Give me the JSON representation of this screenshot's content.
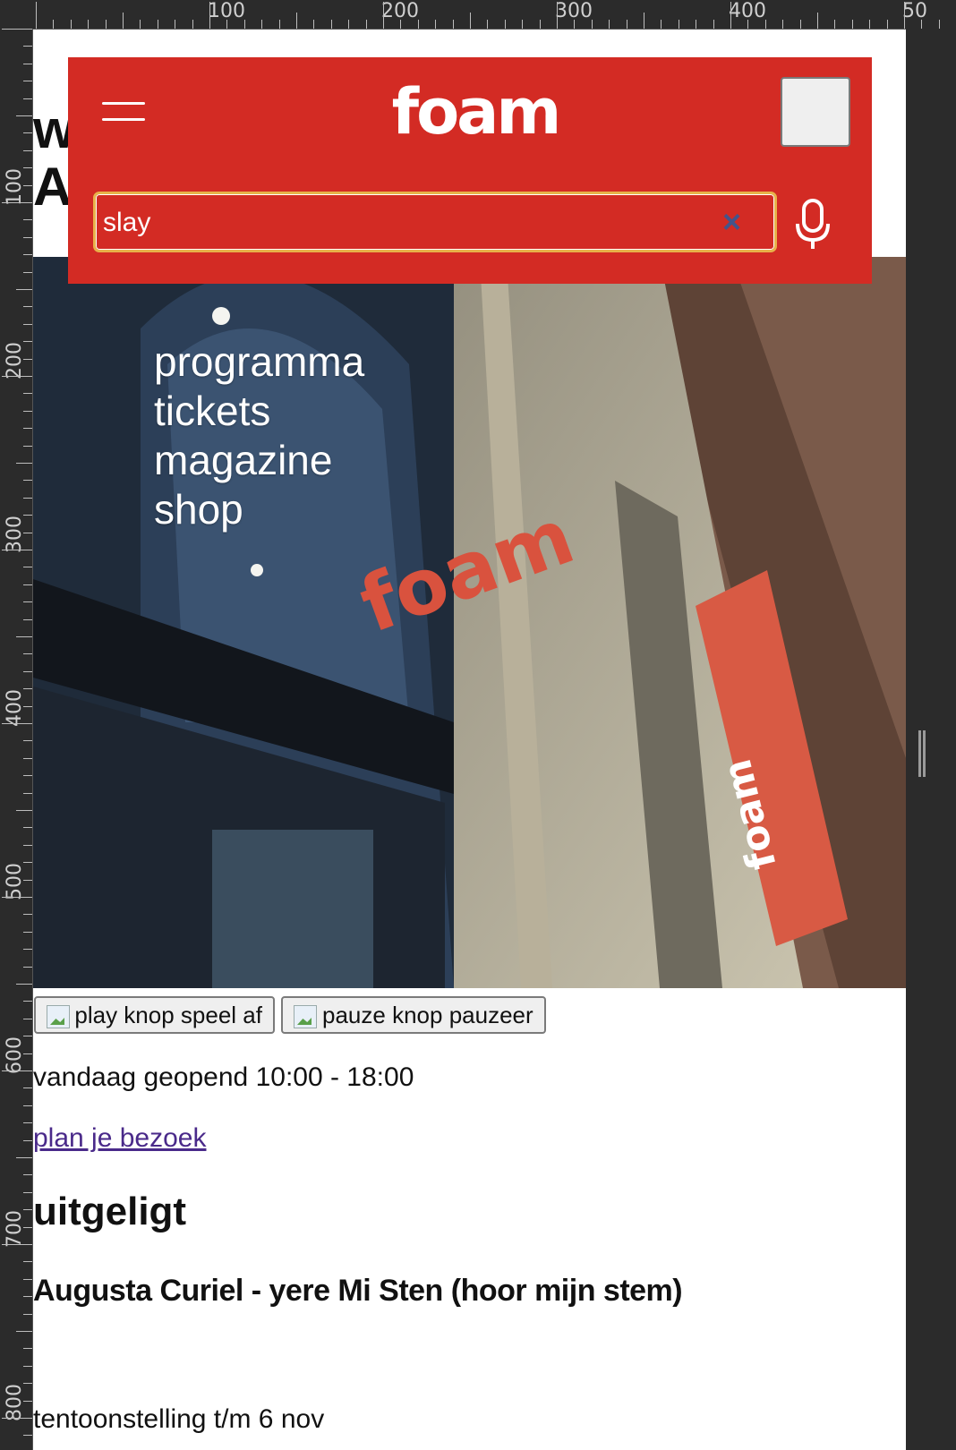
{
  "ruler": {
    "top_labels": [
      "100",
      "200",
      "300",
      "400",
      "50"
    ],
    "left_labels": [
      "100",
      "200",
      "300",
      "400",
      "500",
      "600",
      "700",
      "800"
    ]
  },
  "page": {
    "background_heading": "w\nA"
  },
  "header": {
    "logo": "foam",
    "menu_icon": "hamburger-menu-icon",
    "search": {
      "value": "slay",
      "clear_symbol": "×"
    },
    "mic_icon": "microphone-icon",
    "colors": {
      "header_bg": "#d32b24",
      "search_border": "#e8b24a"
    }
  },
  "nav": {
    "items": [
      "programma",
      "tickets",
      "magazine",
      "shop"
    ]
  },
  "media_controls": {
    "play": {
      "alt": "play knop",
      "label": "speel af"
    },
    "pause": {
      "alt": "pauze knop",
      "label": "pauzeer"
    }
  },
  "info": {
    "hours": "vandaag geopend 10:00 - 18:00",
    "plan_link": "plan je bezoek"
  },
  "featured": {
    "heading": "uitgeligt",
    "item_title": "Augusta Curiel - yere Mi Sten (hoor mijn stem)",
    "item_meta": "tentoonstelling t/m 6 nov"
  },
  "hero": {
    "building_sign": "foam",
    "banner_text": "foam"
  }
}
